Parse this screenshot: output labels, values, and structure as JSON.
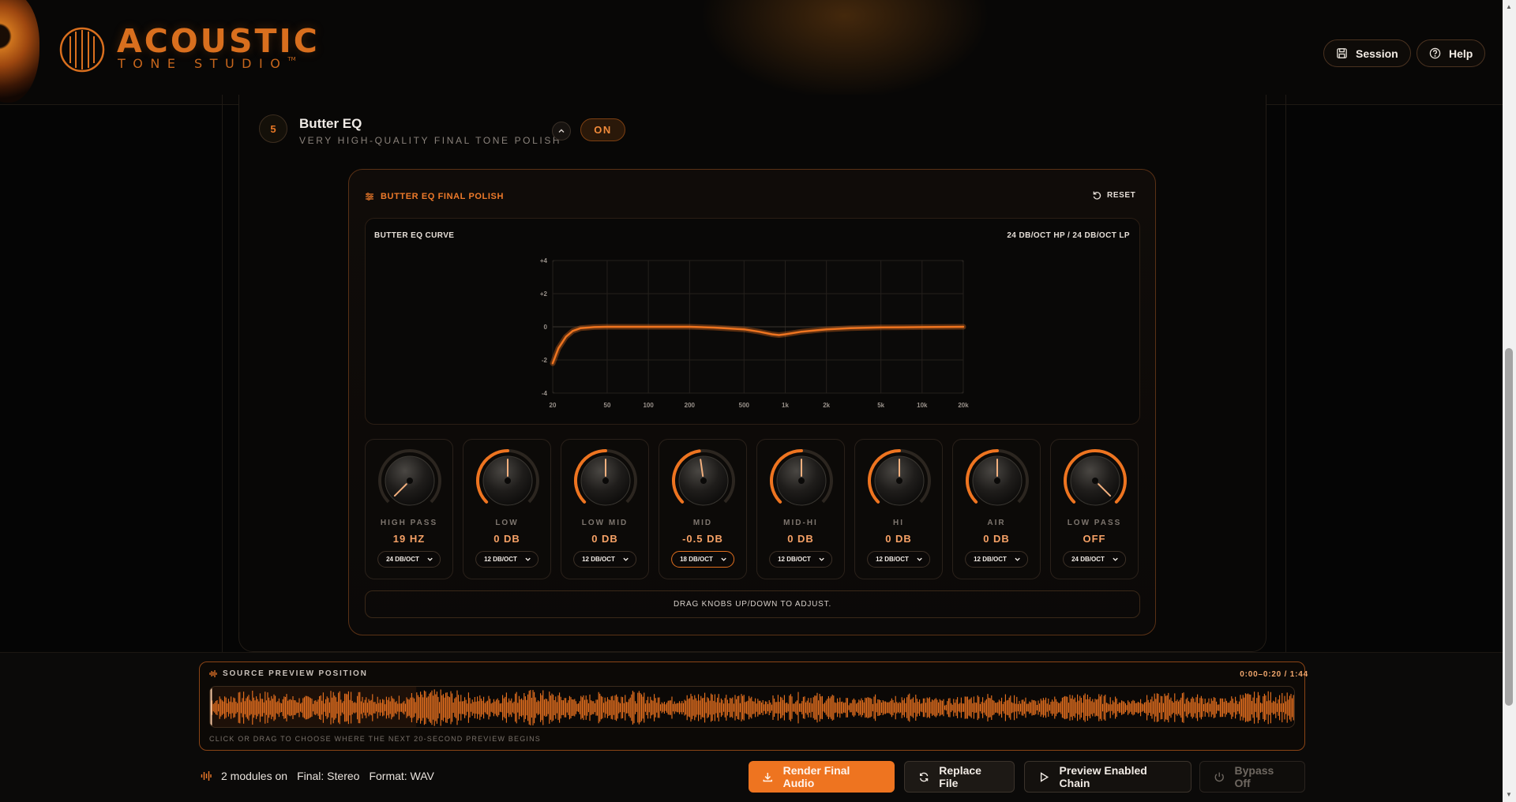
{
  "colors": {
    "accent": "#ee7420",
    "accent_text": "#f6a166",
    "background": "#050505"
  },
  "header": {
    "brand_title": "ACOUSTIC",
    "brand_subtitle": "TONE STUDIO",
    "brand_tm": "TM",
    "session_label": "Session",
    "help_label": "Help"
  },
  "module": {
    "number": "5",
    "title": "Butter EQ",
    "subtitle": "VERY HIGH-QUALITY FINAL TONE POLISH",
    "toggle_label": "ON"
  },
  "eq": {
    "panel_title": "BUTTER EQ FINAL POLISH",
    "reset_label": "RESET",
    "curve_label": "BUTTER EQ CURVE",
    "curve_mode": "24 DB/OCT HP / 24 DB/OCT LP",
    "hint": "DRAG KNOBS UP/DOWN TO ADJUST."
  },
  "chart_data": {
    "type": "line",
    "title": "BUTTER EQ CURVE",
    "xscale": "log",
    "xlim": [
      20,
      20000
    ],
    "ylim": [
      -4,
      4
    ],
    "x_ticks": [
      "20",
      "50",
      "100",
      "200",
      "500",
      "1k",
      "2k",
      "5k",
      "10k",
      "20k"
    ],
    "y_ticks": [
      "+4",
      "+2",
      "0",
      "-2",
      "-4"
    ],
    "grid": true,
    "series": [
      {
        "x": [
          20,
          22,
          25,
          28,
          32,
          40,
          50,
          70,
          100,
          200,
          300,
          500,
          650,
          800,
          900,
          1000,
          1300,
          2000,
          3000,
          5000,
          10000,
          20000
        ],
        "y": [
          -2.2,
          -1.3,
          -0.6,
          -0.25,
          -0.08,
          -0.02,
          0,
          0,
          0,
          0,
          -0.05,
          -0.15,
          -0.3,
          -0.45,
          -0.5,
          -0.45,
          -0.3,
          -0.15,
          -0.08,
          -0.04,
          -0.02,
          0
        ]
      }
    ]
  },
  "knobs": [
    {
      "label": "HIGH PASS",
      "value": "19 HZ",
      "slope": "24 DB/OCT",
      "fraction": 0.0,
      "active": false
    },
    {
      "label": "LOW",
      "value": "0 DB",
      "slope": "12 DB/OCT",
      "fraction": 0.5,
      "active": false
    },
    {
      "label": "LOW MID",
      "value": "0 DB",
      "slope": "12 DB/OCT",
      "fraction": 0.5,
      "active": false
    },
    {
      "label": "MID",
      "value": "-0.5 DB",
      "slope": "18 DB/OCT",
      "fraction": 0.47,
      "active": true
    },
    {
      "label": "MID-HI",
      "value": "0 DB",
      "slope": "12 DB/OCT",
      "fraction": 0.5,
      "active": false
    },
    {
      "label": "HI",
      "value": "0 DB",
      "slope": "12 DB/OCT",
      "fraction": 0.5,
      "active": false
    },
    {
      "label": "AIR",
      "value": "0 DB",
      "slope": "12 DB/OCT",
      "fraction": 0.5,
      "active": false
    },
    {
      "label": "LOW PASS",
      "value": "OFF",
      "slope": "24 DB/OCT",
      "fraction": 1.0,
      "active": false
    }
  ],
  "preview": {
    "title": "SOURCE PREVIEW POSITION",
    "time_range": "0:00–0:20 / 1:44",
    "hint": "CLICK OR DRAG TO CHOOSE WHERE THE NEXT 20-SECOND PREVIEW BEGINS",
    "selection_fraction": 0.19
  },
  "status": {
    "modules": "2 modules on",
    "final": "Final: Stereo",
    "format": "Format: WAV"
  },
  "actions": {
    "render": "Render Final Audio",
    "replace": "Replace File",
    "preview": "Preview Enabled Chain",
    "bypass": "Bypass Off"
  }
}
